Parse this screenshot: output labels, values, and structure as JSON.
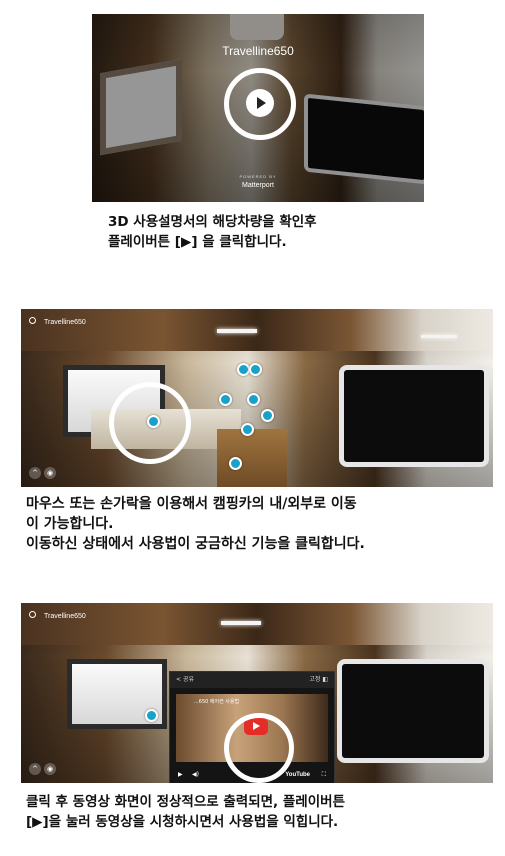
{
  "panel1": {
    "title": "Travelline650",
    "powered_by": "POWERED BY",
    "brand": "Matterport",
    "caption_lines": [
      "3D 사용설명서의 해당차량을 확인후",
      "플레이버튼 [▶] 을 클릭합니다."
    ]
  },
  "panel2": {
    "location_label": "Travelline650",
    "caption_lines": [
      "마우스 또는 손가락을 이용해서 캠핑카의 내/외부로 이동",
      "이 가능합니다.",
      "이동하신 상태에서 사용법이 궁금하신 기능을 클릭합니다."
    ]
  },
  "panel3": {
    "location_label": "Travelline650",
    "popup": {
      "share_label": "공유",
      "close_label": "고정",
      "video_title": "...650 에어컨 사용법",
      "youtube_label": "YouTube"
    },
    "caption_lines": [
      "클릭 후 동영상 화면이 정상적으로 출력되면, 플레이버튼",
      "[▶]을 눌러 동영상을 시청하시면서 사용법을 익힙니다."
    ]
  },
  "colors": {
    "hotspot": "#19a2c9",
    "highlight_ring": "#ffffff",
    "youtube_red": "#e52d27"
  }
}
